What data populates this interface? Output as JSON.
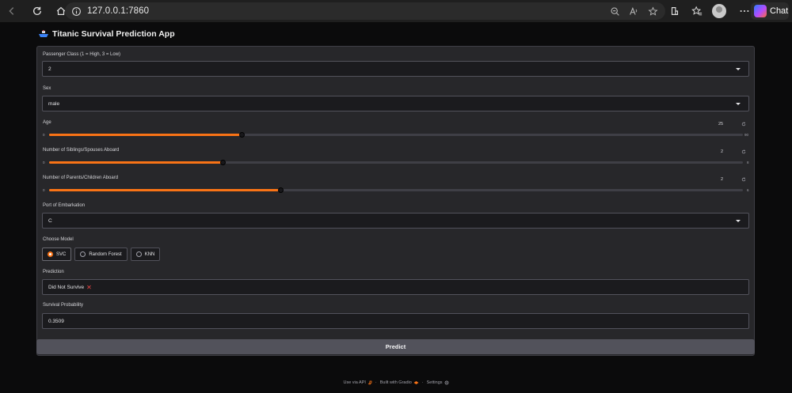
{
  "browser": {
    "url": "127.0.0.1:7860",
    "chat_label": "Chat"
  },
  "app": {
    "title": "Titanic Survival Prediction App",
    "pclass": {
      "label": "Passenger Class (1 = High, 3 = Low)",
      "value": "2"
    },
    "sex": {
      "label": "Sex",
      "value": "male"
    },
    "age": {
      "label": "Age",
      "value": "25",
      "value_num": 25,
      "min": "0",
      "max": "90",
      "min_num": 0,
      "max_num": 90
    },
    "sibsp": {
      "label": "Number of Siblings/Spouses Aboard",
      "value": "2",
      "value_num": 2,
      "min": "0",
      "max": "8",
      "min_num": 0,
      "max_num": 8
    },
    "parch": {
      "label": "Number of Parents/Children Aboard",
      "value": "2",
      "value_num": 2,
      "min": "0",
      "max": "6",
      "min_num": 0,
      "max_num": 6
    },
    "embarked": {
      "label": "Port of Embarkation",
      "value": "C"
    },
    "model": {
      "label": "Choose Model",
      "options": [
        "SVC",
        "Random Forest",
        "KNN"
      ],
      "selected": "SVC"
    },
    "prediction": {
      "label": "Prediction",
      "value": "Did Not Survive",
      "icon": "x-mark-icon"
    },
    "probability": {
      "label": "Survival Probability",
      "value": "0.3509"
    },
    "predict_button": "Predict"
  },
  "footer": {
    "api": "Use via API",
    "built": "Built with Gradio",
    "settings": "Settings",
    "sep": "·"
  },
  "colors": {
    "accent": "#f97316",
    "panel": "#27272a",
    "button": "#52525b"
  }
}
